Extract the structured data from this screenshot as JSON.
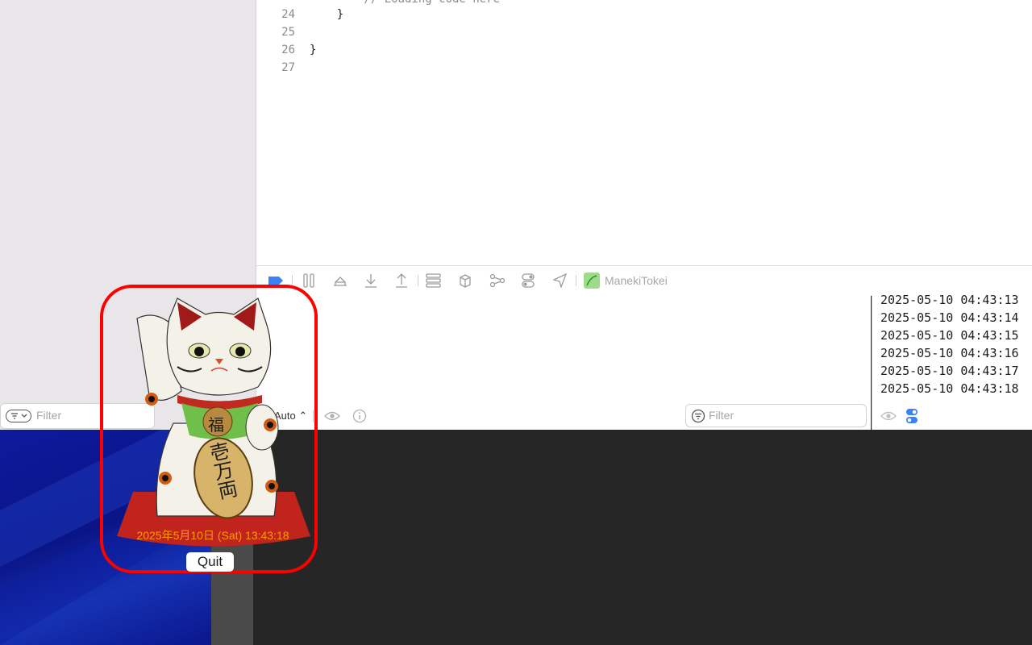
{
  "editor": {
    "line_numbers": [
      "24",
      "25",
      "26",
      "27"
    ],
    "code_lines": [
      "    }",
      "",
      "}",
      ""
    ],
    "partial_top_line": "        // Loading code here"
  },
  "debugbar": {
    "scheme_name": "ManekiTokei",
    "icons": [
      "breakpoint-icon",
      "pause-icon",
      "step-over-icon",
      "step-into-icon",
      "step-out-icon",
      "view-hierarchy-icon",
      "memory-graph-icon",
      "share-icon",
      "environment-icon",
      "location-icon"
    ]
  },
  "console": {
    "output_mode": "Auto ⌃",
    "filter_placeholder": "Filter",
    "log_lines": [
      "2025-05-10 04:43:13",
      "2025-05-10 04:43:14",
      "2025-05-10 04:43:15",
      "2025-05-10 04:43:16",
      "2025-05-10 04:43:17",
      "2025-05-10 04:43:18"
    ]
  },
  "navigator": {
    "filter_placeholder": "Filter"
  },
  "widget": {
    "date_text": "2025年5月10日 (Sat) 13:43:18",
    "coin_text": "福",
    "koban_text": "壱万両",
    "quit_label": "Quit"
  },
  "colors": {
    "widget_border": "#ff0000",
    "clock_text": "#ff9a00",
    "cushion": "#c0241c",
    "accent_blue": "#3a82f7"
  }
}
